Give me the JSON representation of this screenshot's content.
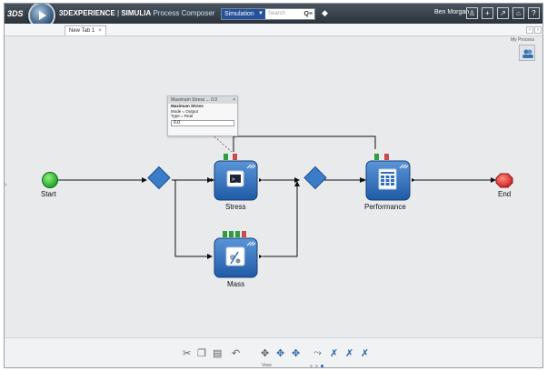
{
  "header": {
    "brand": "3DEXPERIENCE",
    "separator": " | ",
    "app": "SIMULIA",
    "app_sub": " Process Composer",
    "search_scope": "Simulation",
    "search_placeholder": "Search",
    "user_name": "Ben Morgan"
  },
  "tabs": [
    {
      "label": "New Tab 1"
    }
  ],
  "panel": {
    "my_process_label": "My Process"
  },
  "workflow": {
    "start_label": "Start",
    "end_label": "End",
    "stress_label": "Stress",
    "mass_label": "Mass",
    "performance_label": "Performance"
  },
  "popup": {
    "title": "Maximum Stress ... 0.0",
    "name": "Maximum Stress",
    "mode": "Mode = Output",
    "type": "Type = Real",
    "value": "0.0"
  },
  "footer": {
    "view_label": "View"
  },
  "colors": {
    "topbar": "#2b333b",
    "activity_blue": "#2f6fbf",
    "gateway_blue": "#3a7cc8",
    "start_green": "#1fa82a",
    "end_red": "#d8332e",
    "canvas": "#e9eaec"
  }
}
